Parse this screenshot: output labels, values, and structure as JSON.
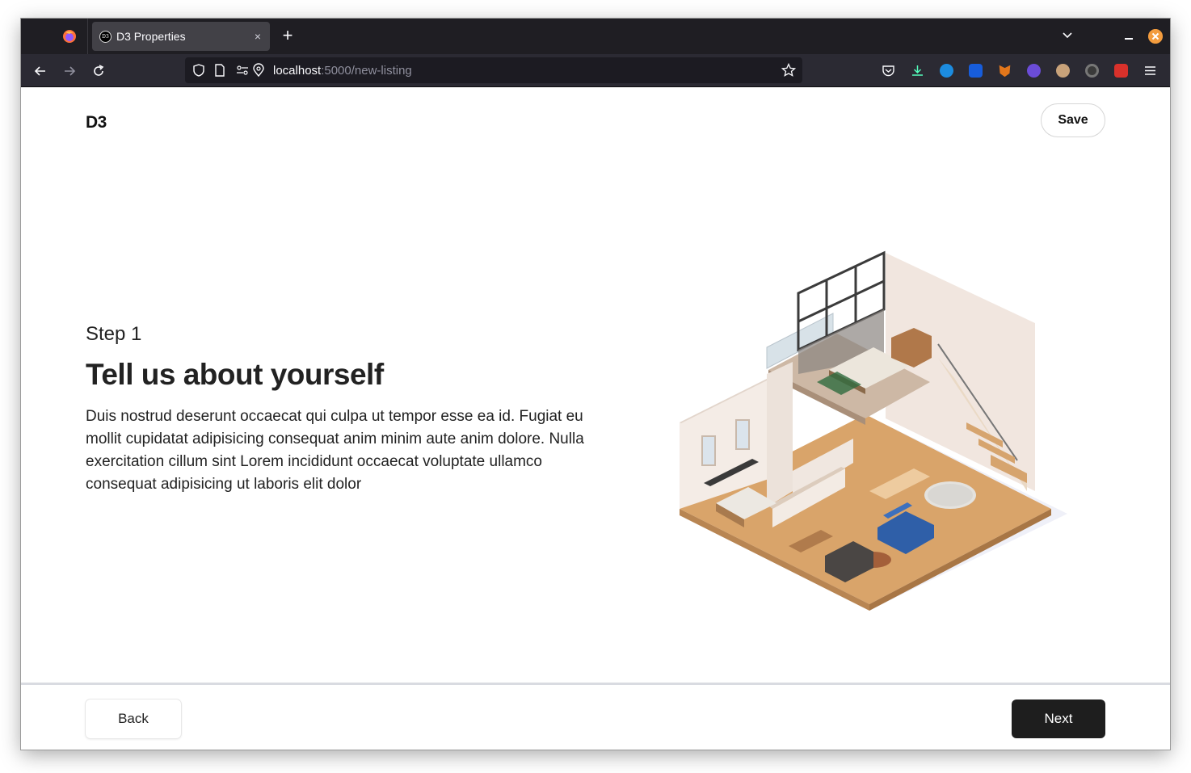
{
  "browser": {
    "tab_title": "D3 Properties",
    "tab_favicon_text": "D3",
    "tab_close": "×",
    "new_tab": "+",
    "url_host": "localhost",
    "url_path": ":5000/new-listing",
    "extensions": [
      "pocket-icon",
      "downloads-icon",
      "extension-blue-icon",
      "bitwarden-icon",
      "metamask-icon",
      "extension-purple-icon",
      "extension-owl-icon",
      "extension-dark-icon",
      "extension-red-icon"
    ],
    "colors": {
      "titlebar": "#1f1e23",
      "toolbar": "#2b2a33",
      "urlbar": "#1c1b22",
      "close": "#f39c3e"
    }
  },
  "header": {
    "brand": "D3",
    "save_label": "Save"
  },
  "main": {
    "step": "Step 1",
    "title": "Tell us about yourself",
    "description": "Duis nostrud deserunt occaecat qui culpa ut tempor esse ea id. Fugiat eu mollit cupidatat adipisicing consequat anim minim aute anim dolore. Nulla exercitation cillum sint Lorem incididunt occaecat voluptate ullamco consequat adipisicing ut laboris elit dolor",
    "illustration": "isometric-apartment-illustration"
  },
  "footer": {
    "back_label": "Back",
    "next_label": "Next"
  }
}
